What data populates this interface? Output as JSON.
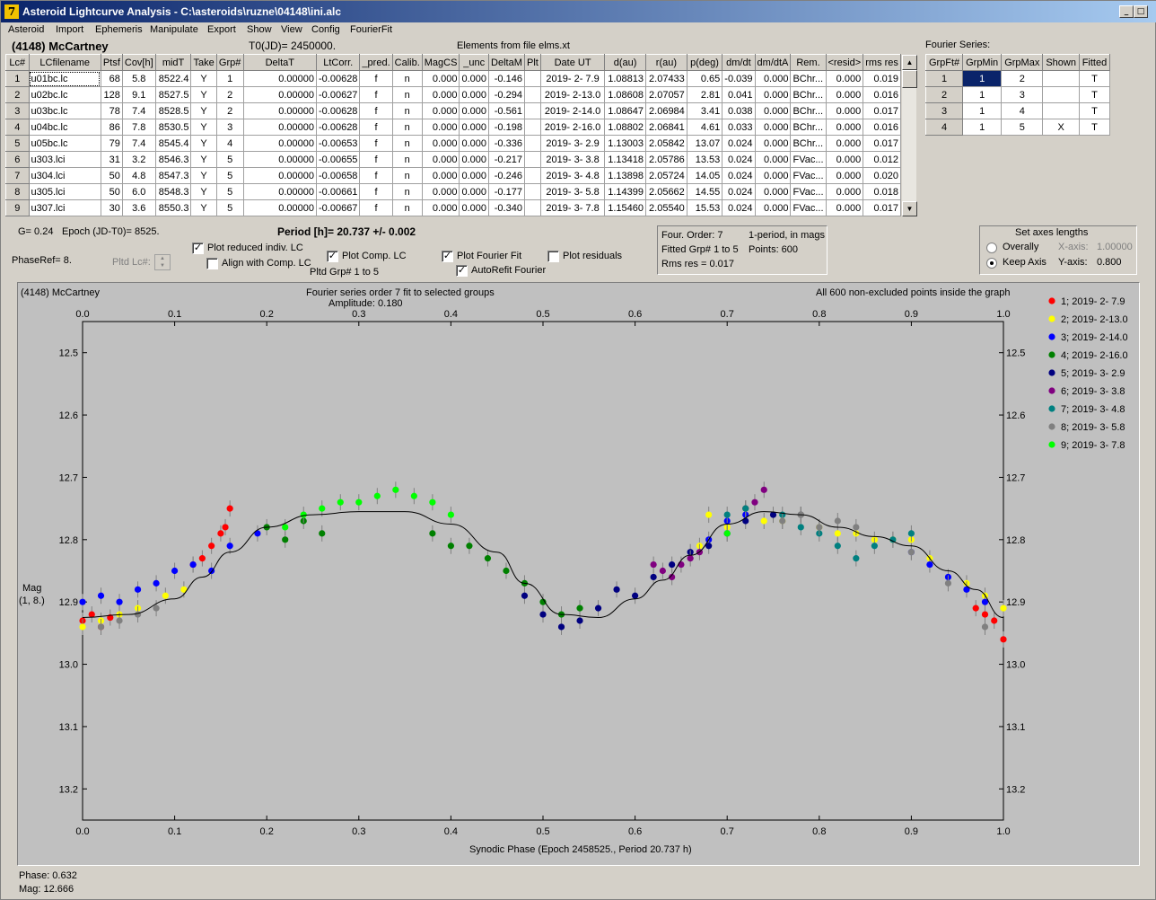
{
  "window": {
    "title": "Asteroid Lightcurve Analysis - C:\\asteroids\\ruzne\\04148\\ini.alc",
    "icon": "7"
  },
  "menu": [
    "Asteroid",
    "Import",
    "Ephemeris",
    "Manipulate",
    "Export",
    "Show",
    "View",
    "Config",
    "FourierFit"
  ],
  "header": {
    "asteroid": "(4148) McCartney",
    "t0": "T0(JD)= 2450000.",
    "elements": "Elements from file elms.xt",
    "fourier_series_label": "Fourier Series:"
  },
  "lc_table": {
    "columns": [
      "Lc#",
      "LCfilename",
      "Ptsf",
      "Cov[h]",
      "midT",
      "Take",
      "Grp#",
      "DeltaT",
      "LtCorr.",
      "_pred.",
      "Calib.",
      "MagCS",
      "_unc",
      "DeltaM",
      "Plt",
      "Date UT",
      "d(au)",
      "r(au)",
      "p(deg)",
      "dm/dt",
      "dm/dtA",
      "Rem.",
      "<resid>",
      "rms res"
    ],
    "rows": [
      [
        "1",
        "u01bc.lc",
        "68",
        "5.8",
        "8522.4",
        "Y",
        "1",
        "0.00000",
        "-0.00628",
        "f",
        "n",
        "0.000",
        "0.000",
        "-0.146",
        "",
        "2019- 2- 7.9",
        "1.08813",
        "2.07433",
        "0.65",
        "-0.039",
        "0.000",
        "BChr...",
        "0.000",
        "0.019"
      ],
      [
        "2",
        "u02bc.lc",
        "128",
        "9.1",
        "8527.5",
        "Y",
        "2",
        "0.00000",
        "-0.00627",
        "f",
        "n",
        "0.000",
        "0.000",
        "-0.294",
        "",
        "2019- 2-13.0",
        "1.08608",
        "2.07057",
        "2.81",
        "0.041",
        "0.000",
        "BChr...",
        "0.000",
        "0.016"
      ],
      [
        "3",
        "u03bc.lc",
        "78",
        "7.4",
        "8528.5",
        "Y",
        "2",
        "0.00000",
        "-0.00628",
        "f",
        "n",
        "0.000",
        "0.000",
        "-0.561",
        "",
        "2019- 2-14.0",
        "1.08647",
        "2.06984",
        "3.41",
        "0.038",
        "0.000",
        "BChr...",
        "0.000",
        "0.017"
      ],
      [
        "4",
        "u04bc.lc",
        "86",
        "7.8",
        "8530.5",
        "Y",
        "3",
        "0.00000",
        "-0.00628",
        "f",
        "n",
        "0.000",
        "0.000",
        "-0.198",
        "",
        "2019- 2-16.0",
        "1.08802",
        "2.06841",
        "4.61",
        "0.033",
        "0.000",
        "BChr...",
        "0.000",
        "0.016"
      ],
      [
        "5",
        "u05bc.lc",
        "79",
        "7.4",
        "8545.4",
        "Y",
        "4",
        "0.00000",
        "-0.00653",
        "f",
        "n",
        "0.000",
        "0.000",
        "-0.336",
        "",
        "2019- 3- 2.9",
        "1.13003",
        "2.05842",
        "13.07",
        "0.024",
        "0.000",
        "BChr...",
        "0.000",
        "0.017"
      ],
      [
        "6",
        "u303.lci",
        "31",
        "3.2",
        "8546.3",
        "Y",
        "5",
        "0.00000",
        "-0.00655",
        "f",
        "n",
        "0.000",
        "0.000",
        "-0.217",
        "",
        "2019- 3- 3.8",
        "1.13418",
        "2.05786",
        "13.53",
        "0.024",
        "0.000",
        "FVac...",
        "0.000",
        "0.012"
      ],
      [
        "7",
        "u304.lci",
        "50",
        "4.8",
        "8547.3",
        "Y",
        "5",
        "0.00000",
        "-0.00658",
        "f",
        "n",
        "0.000",
        "0.000",
        "-0.246",
        "",
        "2019- 3- 4.8",
        "1.13898",
        "2.05724",
        "14.05",
        "0.024",
        "0.000",
        "FVac...",
        "0.000",
        "0.020"
      ],
      [
        "8",
        "u305.lci",
        "50",
        "6.0",
        "8548.3",
        "Y",
        "5",
        "0.00000",
        "-0.00661",
        "f",
        "n",
        "0.000",
        "0.000",
        "-0.177",
        "",
        "2019- 3- 5.8",
        "1.14399",
        "2.05662",
        "14.55",
        "0.024",
        "0.000",
        "FVac...",
        "0.000",
        "0.018"
      ],
      [
        "9",
        "u307.lci",
        "30",
        "3.6",
        "8550.3",
        "Y",
        "5",
        "0.00000",
        "-0.00667",
        "f",
        "n",
        "0.000",
        "0.000",
        "-0.340",
        "",
        "2019- 3- 7.8",
        "1.15460",
        "2.05540",
        "15.53",
        "0.024",
        "0.000",
        "FVac...",
        "0.000",
        "0.017"
      ]
    ]
  },
  "fourier_table": {
    "columns": [
      "GrpFt#",
      "GrpMin",
      "GrpMax",
      "Shown",
      "Fitted"
    ],
    "rows": [
      [
        "1",
        "1",
        "2",
        "",
        "T"
      ],
      [
        "2",
        "1",
        "3",
        "",
        "T"
      ],
      [
        "3",
        "1",
        "4",
        "",
        "T"
      ],
      [
        "4",
        "1",
        "5",
        "X",
        "T"
      ]
    ]
  },
  "controls": {
    "g_label": "G= 0.24",
    "epoch": "Epoch (JD-T0)= 8525.",
    "period": "Period [h]= 20.737 +/- 0.002",
    "phaseref": "PhaseRef= 8.",
    "pltd_lc": "Pltd Lc#:",
    "plot_reduced": "Plot reduced indiv. LC",
    "align": "Align with Comp. LC",
    "plot_comp": "Plot Comp. LC",
    "pltd_grp": "Pltd Grp#  1   to   5",
    "plot_fourier": "Plot Fourier Fit",
    "autorefit": "AutoRefit Fourier",
    "plot_resid": "Plot residuals",
    "four_order": "Four. Order:  7",
    "one_period": "1-period, in mags",
    "fitted_grp": "Fitted Grp# 1 to 5",
    "points": "Points: 600",
    "rms_res": "Rms res     = 0.017",
    "axes_title": "Set axes lengths",
    "overally": "Overally",
    "keep_axis": "Keep Axis",
    "xaxis_label": "X-axis:",
    "xaxis_val": "1.00000",
    "yaxis_label": "Y-axis:",
    "yaxis_val": "0.800"
  },
  "plot": {
    "title_left": "(4148) McCartney",
    "title_center": "Fourier series order 7 fit to selected groups",
    "amplitude": "Amplitude: 0.180",
    "title_right": "All 600 non-excluded points inside the graph",
    "ylabel": "Mag",
    "ylabel2": "(1, 8.)",
    "xlabel": "Synodic Phase (Epoch 2458525., Period 20.737 h)"
  },
  "chart_data": {
    "type": "scatter",
    "xlim": [
      0,
      1
    ],
    "ylim": [
      12.45,
      13.25
    ],
    "y_inverted": true,
    "xticks": [
      "0.0",
      "0.1",
      "0.2",
      "0.3",
      "0.4",
      "0.5",
      "0.6",
      "0.7",
      "0.8",
      "0.9",
      "1.0"
    ],
    "yticks": [
      "12.5",
      "12.6",
      "12.7",
      "12.8",
      "12.9",
      "13.0",
      "13.1",
      "13.2"
    ],
    "fourier_fit": [
      [
        0.0,
        12.925
      ],
      [
        0.05,
        12.92
      ],
      [
        0.1,
        12.895
      ],
      [
        0.13,
        12.86
      ],
      [
        0.16,
        12.82
      ],
      [
        0.2,
        12.78
      ],
      [
        0.25,
        12.76
      ],
      [
        0.3,
        12.755
      ],
      [
        0.35,
        12.755
      ],
      [
        0.4,
        12.775
      ],
      [
        0.45,
        12.82
      ],
      [
        0.48,
        12.87
      ],
      [
        0.52,
        12.92
      ],
      [
        0.56,
        12.925
      ],
      [
        0.6,
        12.895
      ],
      [
        0.63,
        12.865
      ],
      [
        0.66,
        12.825
      ],
      [
        0.7,
        12.775
      ],
      [
        0.74,
        12.755
      ],
      [
        0.78,
        12.76
      ],
      [
        0.82,
        12.78
      ],
      [
        0.86,
        12.795
      ],
      [
        0.9,
        12.81
      ],
      [
        0.94,
        12.85
      ],
      [
        0.97,
        12.88
      ],
      [
        1.0,
        12.925
      ]
    ],
    "series": [
      {
        "name": "1; 2019- 2- 7.9",
        "color": "#ff0000",
        "x": [
          0.0,
          0.01,
          0.02,
          0.03,
          0.12,
          0.13,
          0.14,
          0.15,
          0.155,
          0.16,
          0.97,
          0.98,
          0.99,
          1.0
        ],
        "y": [
          12.93,
          12.92,
          12.94,
          12.925,
          12.84,
          12.83,
          12.81,
          12.79,
          12.78,
          12.75,
          12.91,
          12.92,
          12.93,
          12.96
        ]
      },
      {
        "name": "2; 2019- 2-13.0",
        "color": "#ffff00",
        "x": [
          0.0,
          0.02,
          0.04,
          0.06,
          0.09,
          0.11,
          0.67,
          0.68,
          0.7,
          0.72,
          0.74,
          0.76,
          0.78,
          0.8,
          0.82,
          0.84,
          0.86,
          0.88,
          0.9,
          0.92,
          0.96,
          0.98,
          1.0
        ],
        "y": [
          12.94,
          12.93,
          12.92,
          12.91,
          12.89,
          12.88,
          12.81,
          12.76,
          12.78,
          12.75,
          12.77,
          12.77,
          12.76,
          12.78,
          12.79,
          12.79,
          12.8,
          12.8,
          12.8,
          12.83,
          12.87,
          12.89,
          12.91
        ]
      },
      {
        "name": "3; 2019- 2-14.0",
        "color": "#0000ff",
        "x": [
          0.0,
          0.02,
          0.04,
          0.06,
          0.08,
          0.1,
          0.12,
          0.14,
          0.16,
          0.19,
          0.68,
          0.7,
          0.72,
          0.9,
          0.92,
          0.94,
          0.96,
          0.98
        ],
        "y": [
          12.9,
          12.89,
          12.9,
          12.88,
          12.87,
          12.85,
          12.84,
          12.85,
          12.81,
          12.79,
          12.8,
          12.77,
          12.76,
          12.82,
          12.84,
          12.86,
          12.88,
          12.9
        ]
      },
      {
        "name": "4; 2019- 2-16.0",
        "color": "#008000",
        "x": [
          0.2,
          0.22,
          0.24,
          0.26,
          0.38,
          0.4,
          0.42,
          0.44,
          0.46,
          0.48,
          0.5,
          0.52,
          0.54
        ],
        "y": [
          12.78,
          12.8,
          12.77,
          12.79,
          12.79,
          12.81,
          12.81,
          12.83,
          12.85,
          12.87,
          12.9,
          12.92,
          12.91
        ]
      },
      {
        "name": "5; 2019- 3- 2.9",
        "color": "#000080",
        "x": [
          0.48,
          0.5,
          0.52,
          0.54,
          0.56,
          0.58,
          0.6,
          0.62,
          0.64,
          0.66,
          0.68,
          0.7,
          0.72,
          0.75,
          0.78
        ],
        "y": [
          12.89,
          12.92,
          12.94,
          12.93,
          12.91,
          12.88,
          12.89,
          12.86,
          12.84,
          12.82,
          12.81,
          12.79,
          12.77,
          12.76,
          12.76
        ]
      },
      {
        "name": "6; 2019- 3- 3.8",
        "color": "#800080",
        "x": [
          0.62,
          0.63,
          0.64,
          0.65,
          0.66,
          0.67,
          0.72,
          0.73,
          0.74
        ],
        "y": [
          12.84,
          12.85,
          12.86,
          12.84,
          12.83,
          12.82,
          12.75,
          12.74,
          12.72
        ]
      },
      {
        "name": "7; 2019- 3- 4.8",
        "color": "#008080",
        "x": [
          0.7,
          0.72,
          0.76,
          0.78,
          0.8,
          0.82,
          0.84,
          0.86,
          0.88,
          0.9
        ],
        "y": [
          12.76,
          12.75,
          12.76,
          12.78,
          12.79,
          12.81,
          12.83,
          12.81,
          12.8,
          12.79
        ]
      },
      {
        "name": "8; 2019- 3- 5.8",
        "color": "#808080",
        "x": [
          0.02,
          0.04,
          0.06,
          0.08,
          0.76,
          0.78,
          0.8,
          0.82,
          0.84,
          0.9,
          0.94,
          0.98
        ],
        "y": [
          12.94,
          12.93,
          12.92,
          12.91,
          12.77,
          12.76,
          12.78,
          12.77,
          12.78,
          12.82,
          12.87,
          12.94
        ]
      },
      {
        "name": "9; 2019- 3- 7.8",
        "color": "#00ff00",
        "x": [
          0.22,
          0.24,
          0.26,
          0.28,
          0.3,
          0.32,
          0.34,
          0.36,
          0.38,
          0.4,
          0.7
        ],
        "y": [
          12.78,
          12.76,
          12.75,
          12.74,
          12.74,
          12.73,
          12.72,
          12.73,
          12.74,
          12.76,
          12.79
        ]
      }
    ]
  },
  "status": {
    "phase": "Phase:  0.632",
    "mag": "Mag:    12.666"
  }
}
